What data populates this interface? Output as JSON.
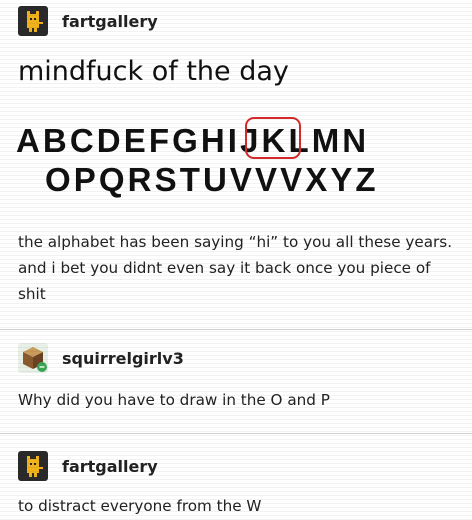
{
  "posts": [
    {
      "username": "fartgallery",
      "title": "mindfuck of the day",
      "alphabet_line1": "ABCDEFGHIJKLMN",
      "alphabet_line2": "OPQRSTUVVVXYZ",
      "body": "the alphabet has been saying “hi” to you all these years. and i bet you didnt even say it back once you piece of shit"
    },
    {
      "username": "squirrelgirlv3",
      "body": "Why did you have to draw in the O and P"
    },
    {
      "username": "fartgallery",
      "body": "to distract everyone from the W"
    }
  ],
  "colors": {
    "highlight_circle": "#d42a2a",
    "text": "#111111"
  },
  "icons": [
    "cat-avatar-icon",
    "cube-avatar-icon",
    "cat-avatar-icon"
  ]
}
